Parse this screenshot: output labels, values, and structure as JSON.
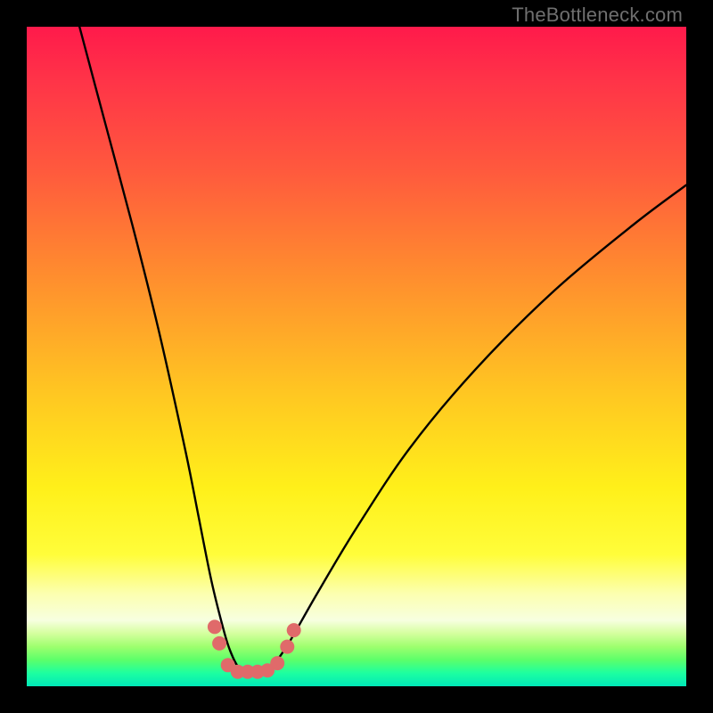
{
  "watermark": "TheBottleneck.com",
  "chart_data": {
    "type": "line",
    "title": "",
    "xlabel": "",
    "ylabel": "",
    "xlim": [
      0,
      100
    ],
    "ylim": [
      0,
      100
    ],
    "series": [
      {
        "name": "bottleneck-curve",
        "x": [
          8,
          12,
          16,
          20,
          24,
          26,
          28,
          30,
          31,
          32,
          33,
          34,
          35,
          36,
          37,
          38,
          40,
          44,
          50,
          58,
          68,
          80,
          92,
          100
        ],
        "values": [
          100,
          85,
          70,
          54,
          36,
          26,
          16,
          8,
          5,
          3,
          2,
          2,
          2,
          2,
          3,
          4,
          7,
          14,
          24,
          36,
          48,
          60,
          70,
          76
        ]
      }
    ],
    "markers": {
      "name": "highlight-dots",
      "color": "#e06a6a",
      "points": [
        {
          "x": 28.5,
          "y": 9.0
        },
        {
          "x": 29.2,
          "y": 6.5
        },
        {
          "x": 30.5,
          "y": 3.2
        },
        {
          "x": 32.0,
          "y": 2.2
        },
        {
          "x": 33.5,
          "y": 2.2
        },
        {
          "x": 35.0,
          "y": 2.2
        },
        {
          "x": 36.5,
          "y": 2.4
        },
        {
          "x": 38.0,
          "y": 3.5
        },
        {
          "x": 39.5,
          "y": 6.0
        },
        {
          "x": 40.5,
          "y": 8.5
        }
      ]
    },
    "background_gradient": {
      "top": "#ff1a4b",
      "upper_mid": "#ffc522",
      "lower_mid": "#fffd3a",
      "bottom": "#00e8b8"
    }
  }
}
